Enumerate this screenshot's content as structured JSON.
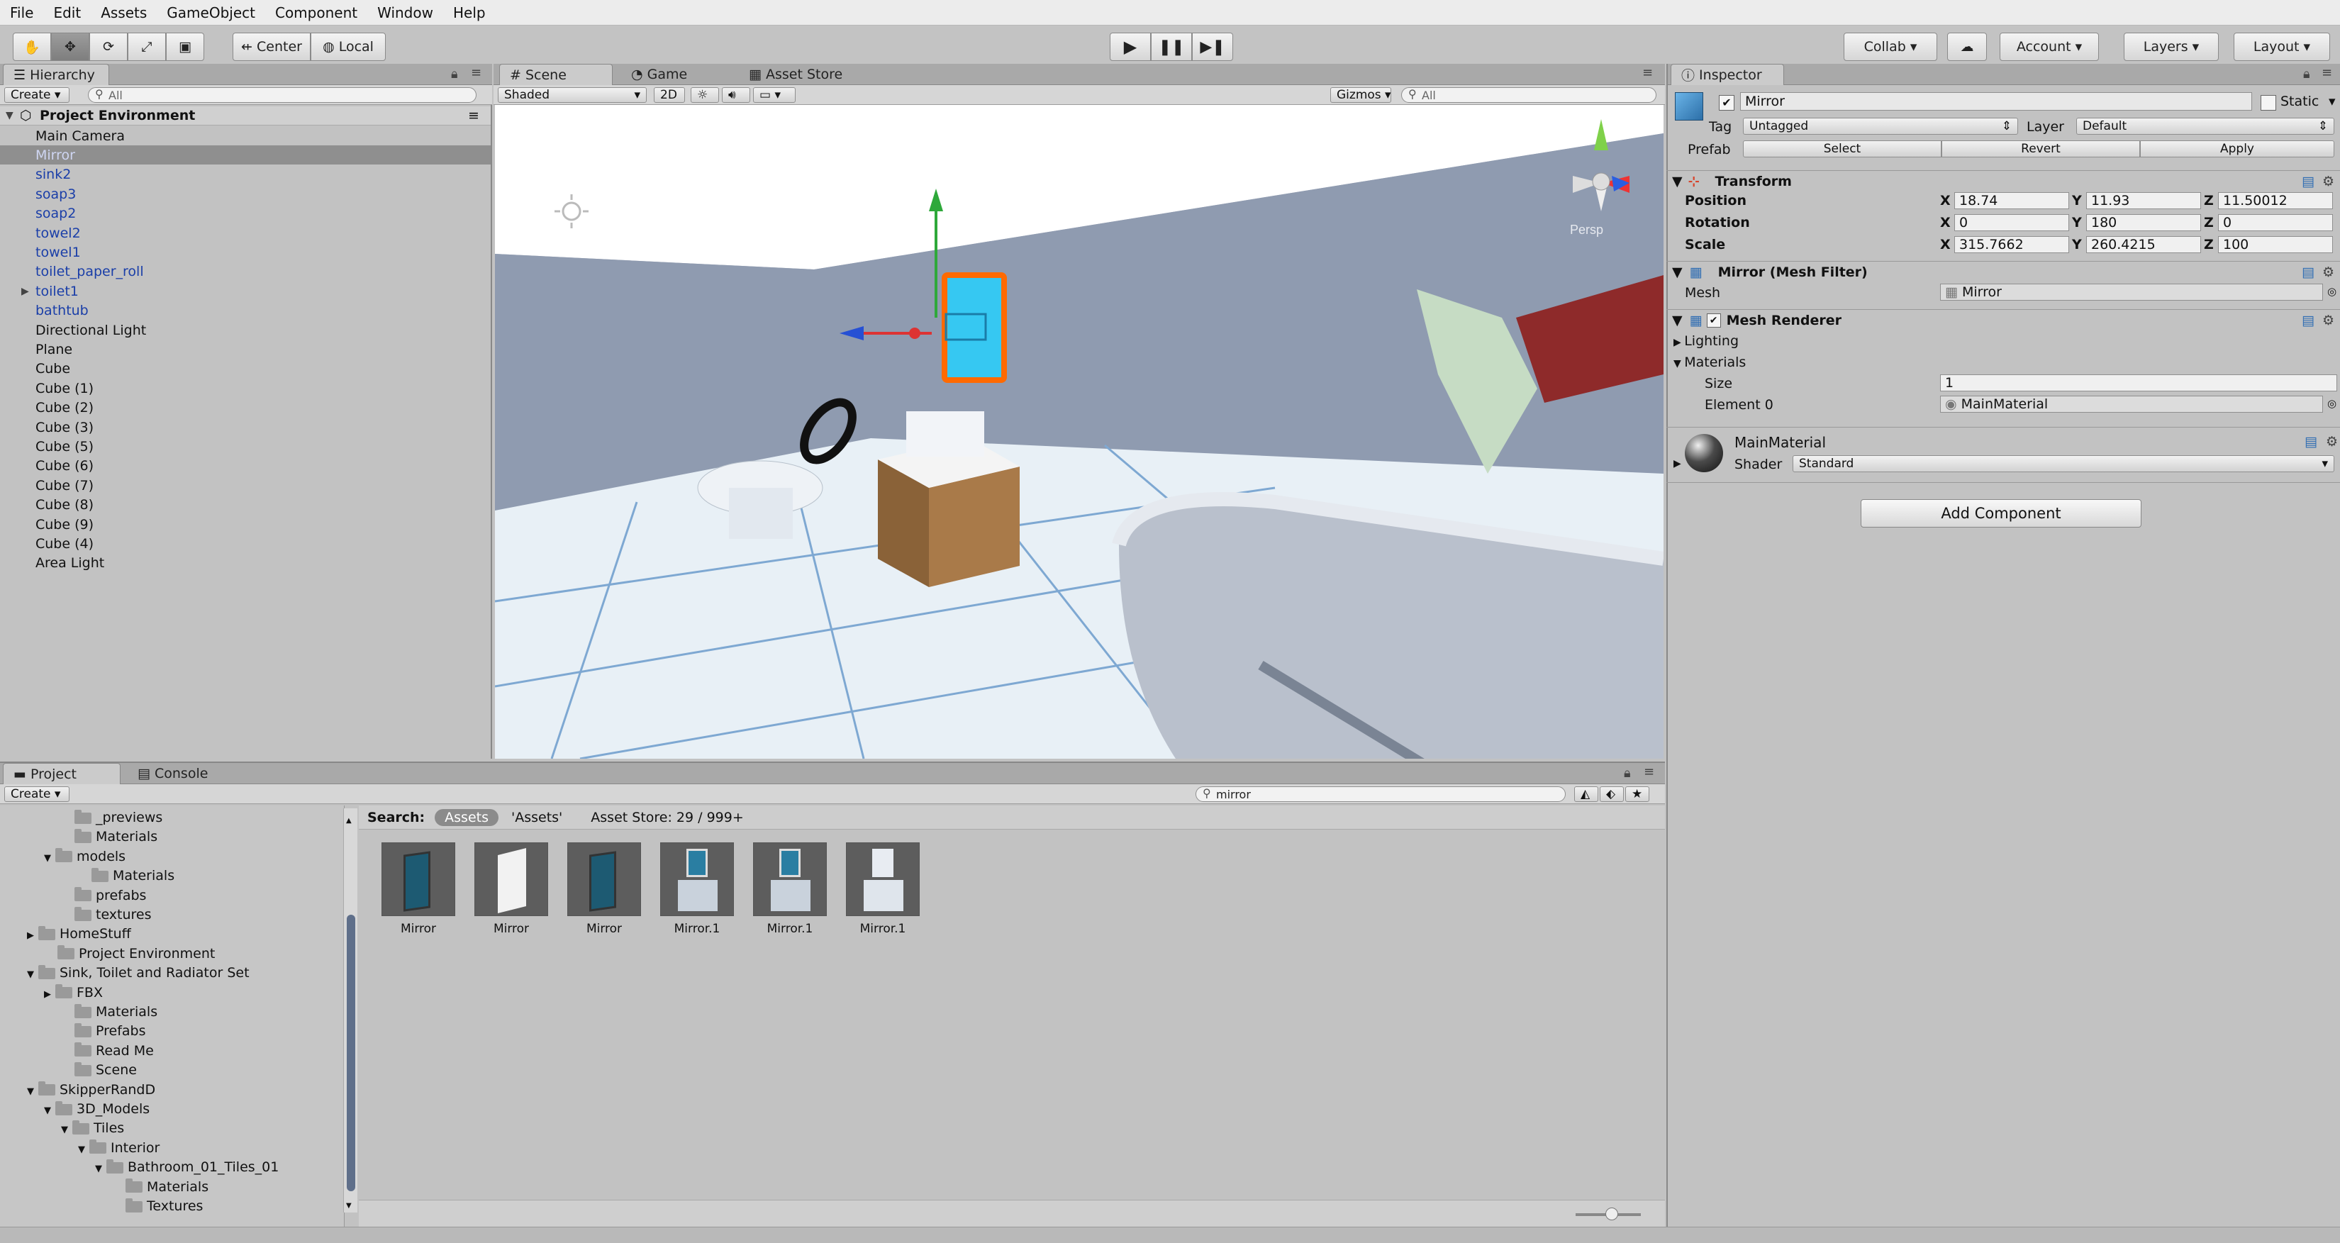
{
  "menu": [
    "File",
    "Edit",
    "Assets",
    "GameObject",
    "Component",
    "Window",
    "Help"
  ],
  "toolbar": {
    "center": "Center",
    "local": "Local",
    "collab": "Collab ▾",
    "account": "Account",
    "layers": "Layers",
    "layout": "Layout"
  },
  "hierarchy": {
    "tab": "Hierarchy",
    "create": "Create",
    "search_placeholder": "All",
    "scene": "Project Environment",
    "items": [
      {
        "label": "Main Camera",
        "prefab": false
      },
      {
        "label": "Mirror",
        "prefab": true,
        "selected": true
      },
      {
        "label": "sink2",
        "prefab": true
      },
      {
        "label": "soap3",
        "prefab": true
      },
      {
        "label": "soap2",
        "prefab": true
      },
      {
        "label": "towel2",
        "prefab": true
      },
      {
        "label": "towel1",
        "prefab": true
      },
      {
        "label": "toilet_paper_roll",
        "prefab": true
      },
      {
        "label": "toilet1",
        "prefab": true,
        "expandable": true
      },
      {
        "label": "bathtub",
        "prefab": true
      },
      {
        "label": "Directional Light",
        "prefab": false
      },
      {
        "label": "Plane",
        "prefab": false
      },
      {
        "label": "Cube",
        "prefab": false
      },
      {
        "label": "Cube (1)",
        "prefab": false
      },
      {
        "label": "Cube (2)",
        "prefab": false
      },
      {
        "label": "Cube (3)",
        "prefab": false
      },
      {
        "label": "Cube (5)",
        "prefab": false
      },
      {
        "label": "Cube (6)",
        "prefab": false
      },
      {
        "label": "Cube (7)",
        "prefab": false
      },
      {
        "label": "Cube (8)",
        "prefab": false
      },
      {
        "label": "Cube (9)",
        "prefab": false
      },
      {
        "label": "Cube (4)",
        "prefab": false
      },
      {
        "label": "Area Light",
        "prefab": false
      }
    ]
  },
  "scene": {
    "tabs": [
      "Scene",
      "Game",
      "Asset Store"
    ],
    "shading": "Shaded",
    "mode_2d": "2D",
    "gizmos": "Gizmos",
    "search_placeholder": "All",
    "persp": "Persp"
  },
  "inspector": {
    "tab": "Inspector",
    "name": "Mirror",
    "static": "Static",
    "tag_label": "Tag",
    "tag": "Untagged",
    "layer_label": "Layer",
    "layer": "Default",
    "prefab_label": "Prefab",
    "select": "Select",
    "revert": "Revert",
    "apply": "Apply",
    "transform": {
      "title": "Transform",
      "position": {
        "label": "Position",
        "x": "18.74",
        "y": "11.93",
        "z": "11.50012"
      },
      "rotation": {
        "label": "Rotation",
        "x": "0",
        "y": "180",
        "z": "0"
      },
      "scale": {
        "label": "Scale",
        "x": "315.7662",
        "y": "260.4215",
        "z": "100"
      }
    },
    "mesh_filter": {
      "title": "Mirror (Mesh Filter)",
      "mesh_label": "Mesh",
      "mesh": "Mirror"
    },
    "mesh_renderer": {
      "title": "Mesh Renderer",
      "lighting": "Lighting",
      "materials": "Materials",
      "size_label": "Size",
      "size": "1",
      "element_label": "Element 0",
      "element": "MainMaterial"
    },
    "material": {
      "name": "MainMaterial",
      "shader_label": "Shader",
      "shader": "Standard"
    },
    "add_component": "Add Component"
  },
  "project": {
    "tabs": [
      "Project",
      "Console"
    ],
    "create": "Create",
    "search_value": "mirror",
    "search_label": "Search:",
    "filter_assets": "Assets",
    "filter_assets_q": "'Assets'",
    "asset_store": "Asset Store: 29 / 999+",
    "tree": [
      {
        "label": "_previews",
        "indent": 3
      },
      {
        "label": "Materials",
        "indent": 3
      },
      {
        "label": "models",
        "indent": 2,
        "open": true
      },
      {
        "label": "Materials",
        "indent": 4
      },
      {
        "label": "prefabs",
        "indent": 3
      },
      {
        "label": "textures",
        "indent": 3
      },
      {
        "label": "HomeStuff",
        "indent": 1,
        "closed": true
      },
      {
        "label": "Project Environment",
        "indent": 2
      },
      {
        "label": "Sink, Toilet and Radiator Set",
        "indent": 1,
        "open": true
      },
      {
        "label": "FBX",
        "indent": 2,
        "closed": true
      },
      {
        "label": "Materials",
        "indent": 3
      },
      {
        "label": "Prefabs",
        "indent": 3
      },
      {
        "label": "Read Me",
        "indent": 3
      },
      {
        "label": "Scene",
        "indent": 3
      },
      {
        "label": "SkipperRandD",
        "indent": 1,
        "open": true
      },
      {
        "label": "3D_Models",
        "indent": 2,
        "open": true
      },
      {
        "label": "Tiles",
        "indent": 3,
        "open": true
      },
      {
        "label": "Interior",
        "indent": 4,
        "open": true
      },
      {
        "label": "Bathroom_01_Tiles_01",
        "indent": 5,
        "open": true
      },
      {
        "label": "Materials",
        "indent": 6
      },
      {
        "label": "Textures",
        "indent": 6
      }
    ],
    "assets": [
      {
        "label": "Mirror",
        "style": "dark"
      },
      {
        "label": "Mirror",
        "style": "white"
      },
      {
        "label": "Mirror",
        "style": "dark"
      },
      {
        "label": "Mirror.1",
        "style": "sink"
      },
      {
        "label": "Mirror.1",
        "style": "sink"
      },
      {
        "label": "Mirror.1",
        "style": "sinkwhite"
      }
    ]
  }
}
